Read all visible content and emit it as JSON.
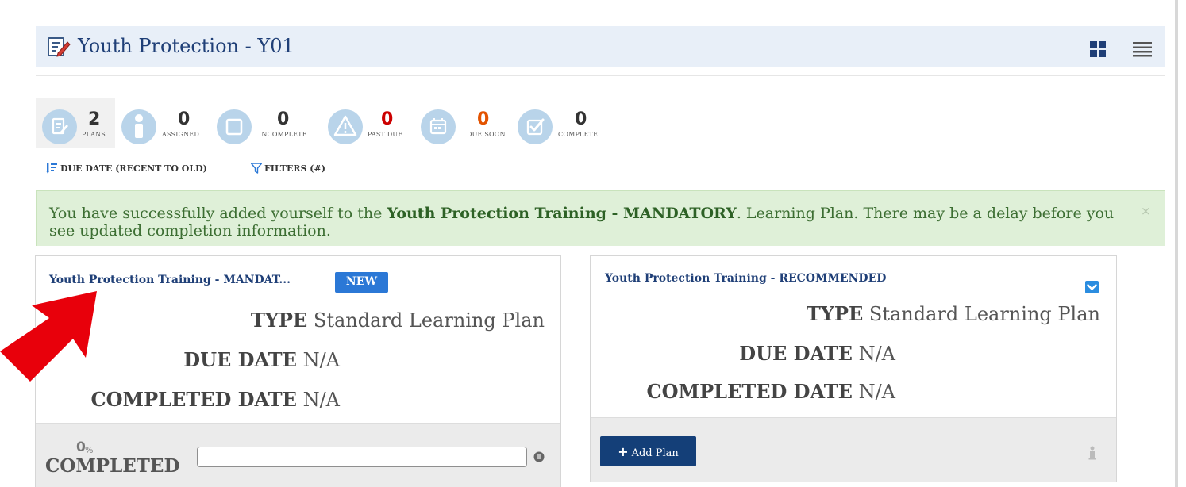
{
  "header": {
    "title": "Youth Protection - Y01",
    "icons": {
      "plan": "edit-document-icon",
      "grid_view": "grid-view-icon",
      "list_view": "list-view-icon"
    },
    "background": "#e8eff8",
    "title_color": "#1f3f77"
  },
  "stats": [
    {
      "count": "2",
      "label": "PLANS",
      "icon": "document-edit-icon",
      "active": true
    },
    {
      "count": "0",
      "label": "ASSIGNED",
      "icon": "info-person-icon"
    },
    {
      "count": "0",
      "label": "INCOMPLETE",
      "icon": "empty-square-icon"
    },
    {
      "count": "0",
      "label": "PAST DUE",
      "icon": "warning-icon",
      "color": "#cc0000"
    },
    {
      "count": "0",
      "label": "DUE SOON",
      "icon": "calendar-icon",
      "color": "#e35300"
    },
    {
      "count": "0",
      "label": "COMPLETE",
      "icon": "checked-box-icon"
    }
  ],
  "toolbar": {
    "sort_label": "DUE DATE (RECENT TO OLD)",
    "filters_label": "FILTERS (#)"
  },
  "alert": {
    "text_before": "You have successfully added yourself to the ",
    "plan_name": "Youth Protection Training - MANDATORY",
    "text_after": ". Learning Plan. There may be a delay before you see updated completion information.",
    "close_glyph": "×",
    "background": "#dff0d8"
  },
  "cards": [
    {
      "title": "Youth Protection Training - MANDAT...",
      "badge": "NEW",
      "type_label": "TYPE",
      "type_value": "Standard Learning Plan",
      "due_label": "DUE DATE",
      "due_value": "N/A",
      "completed_label": "COMPLETED DATE",
      "completed_value": "N/A",
      "progress": {
        "percent": 0,
        "percent_text": "0",
        "percent_sign": "%",
        "label": "COMPLETED"
      }
    },
    {
      "title": "Youth Protection Training - RECOMMENDED",
      "type_label": "TYPE",
      "type_value": "Standard Learning Plan",
      "due_label": "DUE DATE",
      "due_value": "N/A",
      "completed_label": "COMPLETED DATE",
      "completed_value": "N/A",
      "add_button_label": "Add Plan",
      "add_button_glyph": "+"
    }
  ],
  "colors": {
    "accent": "#2b78d6",
    "button": "#143f78",
    "alert_text": "#3c6e32",
    "past_due": "#cc0000",
    "due_soon": "#e35300",
    "annotation_arrow": "#e8000b"
  }
}
